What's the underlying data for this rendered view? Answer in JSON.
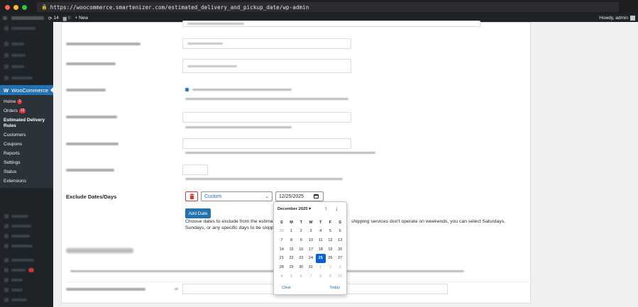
{
  "browser": {
    "url": "https://woocommerce.smartenizer.com/estimated_delivery_and_pickup_date/wp-admin",
    "traffic_colors": [
      "#ff5f57",
      "#febc2e",
      "#28c840"
    ]
  },
  "adminbar": {
    "comments_count": "14",
    "pending_count": "0",
    "new_label": "New",
    "howdy": "Howdy, admin"
  },
  "sidebar": {
    "woo_logo": "W",
    "woocommerce_label": "WooCommerce",
    "submenu": [
      {
        "label": "Home",
        "badge": "1"
      },
      {
        "label": "Orders",
        "badge": "13"
      },
      {
        "label": "Estimated Delivery Rules",
        "badge": ""
      },
      {
        "label": "Customers",
        "badge": ""
      },
      {
        "label": "Coupons",
        "badge": ""
      },
      {
        "label": "Reports",
        "badge": ""
      },
      {
        "label": "Settings",
        "badge": ""
      },
      {
        "label": "Status",
        "badge": ""
      },
      {
        "label": "Extensions",
        "badge": ""
      }
    ]
  },
  "form": {
    "exclude_label": "Exclude Dates/Days",
    "mode_value": "Custom",
    "date_value": "12/25/2025",
    "add_date_label": "Add Date",
    "description_line1": "Choose dates to exclude from the estimat",
    "description_line1_right": "shipping services don't operate on weekends, you can select Saturdays,",
    "description_line2": "Sundays, or any specific days to be skipped"
  },
  "calendar": {
    "month_label": "December 2025 ▾",
    "weekdays": [
      "S",
      "M",
      "T",
      "W",
      "T",
      "F",
      "S"
    ],
    "days": [
      {
        "d": "30",
        "muted": true
      },
      {
        "d": "1"
      },
      {
        "d": "2"
      },
      {
        "d": "3"
      },
      {
        "d": "4"
      },
      {
        "d": "5"
      },
      {
        "d": "6"
      },
      {
        "d": "7"
      },
      {
        "d": "8"
      },
      {
        "d": "9"
      },
      {
        "d": "10"
      },
      {
        "d": "11"
      },
      {
        "d": "12"
      },
      {
        "d": "13"
      },
      {
        "d": "14"
      },
      {
        "d": "15"
      },
      {
        "d": "16"
      },
      {
        "d": "17"
      },
      {
        "d": "18"
      },
      {
        "d": "19"
      },
      {
        "d": "20"
      },
      {
        "d": "21"
      },
      {
        "d": "22"
      },
      {
        "d": "23"
      },
      {
        "d": "24"
      },
      {
        "d": "25",
        "selected": true
      },
      {
        "d": "26"
      },
      {
        "d": "27"
      },
      {
        "d": "28"
      },
      {
        "d": "29"
      },
      {
        "d": "30"
      },
      {
        "d": "31"
      },
      {
        "d": "1",
        "muted": true
      },
      {
        "d": "2",
        "muted": true
      },
      {
        "d": "3",
        "muted": true
      },
      {
        "d": "4",
        "muted": true
      },
      {
        "d": "5",
        "muted": true
      },
      {
        "d": "6",
        "muted": true
      },
      {
        "d": "7",
        "muted": true
      },
      {
        "d": "8",
        "muted": true
      },
      {
        "d": "9",
        "muted": true
      },
      {
        "d": "10",
        "muted": true
      }
    ],
    "clear_label": "Clear",
    "today_label": "Today",
    "selected_color": "#0060df"
  },
  "colors": {
    "accent": "#2271b1",
    "danger": "#d63638",
    "sidebar_bg": "#1d2327"
  }
}
